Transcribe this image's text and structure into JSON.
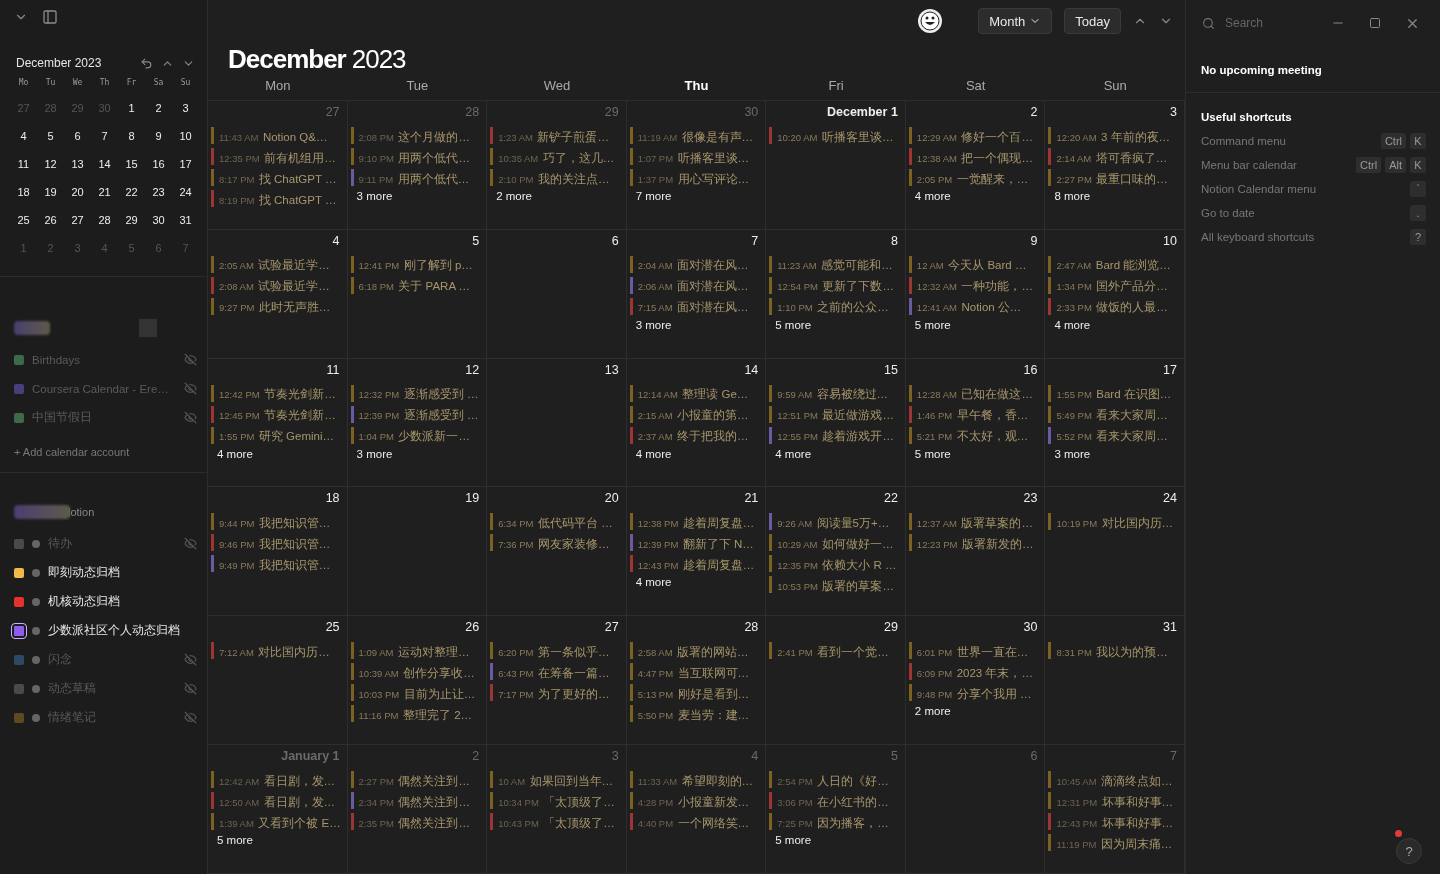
{
  "sidebar": {
    "mini_calendar": {
      "title": "December 2023",
      "weekdays": [
        "Mo",
        "Tu",
        "We",
        "Th",
        "Fr",
        "Sa",
        "Su"
      ],
      "days": [
        {
          "label": "27",
          "muted": true
        },
        {
          "label": "28",
          "muted": true
        },
        {
          "label": "29",
          "muted": true
        },
        {
          "label": "30",
          "muted": true
        },
        {
          "label": "1",
          "muted": false
        },
        {
          "label": "2",
          "muted": false
        },
        {
          "label": "3",
          "muted": false
        },
        {
          "label": "4",
          "muted": false
        },
        {
          "label": "5",
          "muted": false
        },
        {
          "label": "6",
          "muted": false
        },
        {
          "label": "7",
          "muted": false
        },
        {
          "label": "8",
          "muted": false
        },
        {
          "label": "9",
          "muted": false
        },
        {
          "label": "10",
          "muted": false
        },
        {
          "label": "11",
          "muted": false
        },
        {
          "label": "12",
          "muted": false
        },
        {
          "label": "13",
          "muted": false
        },
        {
          "label": "14",
          "muted": false
        },
        {
          "label": "15",
          "muted": false
        },
        {
          "label": "16",
          "muted": false
        },
        {
          "label": "17",
          "muted": false
        },
        {
          "label": "18",
          "muted": false
        },
        {
          "label": "19",
          "muted": false
        },
        {
          "label": "20",
          "muted": false
        },
        {
          "label": "21",
          "muted": false
        },
        {
          "label": "22",
          "muted": false
        },
        {
          "label": "23",
          "muted": false
        },
        {
          "label": "24",
          "muted": false
        },
        {
          "label": "25",
          "muted": false
        },
        {
          "label": "26",
          "muted": false
        },
        {
          "label": "27",
          "muted": false
        },
        {
          "label": "28",
          "muted": false
        },
        {
          "label": "29",
          "muted": false
        },
        {
          "label": "30",
          "muted": false
        },
        {
          "label": "31",
          "muted": false
        },
        {
          "label": "1",
          "muted": true
        },
        {
          "label": "2",
          "muted": true
        },
        {
          "label": "3",
          "muted": true
        },
        {
          "label": "4",
          "muted": true
        },
        {
          "label": "5",
          "muted": true
        },
        {
          "label": "6",
          "muted": true
        },
        {
          "label": "7",
          "muted": true
        }
      ]
    },
    "accounts": [
      {
        "calendars": [
          {
            "name": "Birthdays",
            "color": "#3d6b4a",
            "hidden": true
          },
          {
            "name": "Coursera Calendar - Ere…",
            "color": "#4a3f7a",
            "hidden": true
          },
          {
            "name": "中国节假日",
            "color": "#3d6b4a",
            "hidden": true
          }
        ],
        "add_label": "+ Add calendar account"
      },
      {
        "name": "lotion",
        "calendars": [
          {
            "name": "待办",
            "color": "#4a4a4a",
            "hidden": true,
            "selected": false
          },
          {
            "name": "即刻动态归档",
            "color": "#f2b84b",
            "hidden": false,
            "selected": false
          },
          {
            "name": "机核动态归档",
            "color": "#e5322d",
            "hidden": false,
            "selected": false
          },
          {
            "name": "少数派社区个人动态归档",
            "color": "#8f5cf2",
            "hidden": false,
            "selected": true
          },
          {
            "name": "闪念",
            "color": "#2d4a66",
            "hidden": true,
            "selected": false
          },
          {
            "name": "动态草稿",
            "color": "#4a4a4a",
            "hidden": true,
            "selected": false
          },
          {
            "name": "情绪笔记",
            "color": "#5e4a1e",
            "hidden": true,
            "selected": false
          }
        ]
      }
    ]
  },
  "toolbar": {
    "view": "Month",
    "today": "Today"
  },
  "calendar": {
    "title_month": "December",
    "title_year": "2023",
    "weekdays": [
      {
        "label": "Mon",
        "current": false
      },
      {
        "label": "Tue",
        "current": false
      },
      {
        "label": "Wed",
        "current": false
      },
      {
        "label": "Thu",
        "current": true
      },
      {
        "label": "Fri",
        "current": false
      },
      {
        "label": "Sat",
        "current": false
      },
      {
        "label": "Sun",
        "current": false
      }
    ],
    "days": [
      {
        "label": "27",
        "muted": true,
        "events": [
          {
            "time": "11:43 AM",
            "title": "Notion Q&…",
            "color": "#7d6120"
          },
          {
            "time": "12:35 PM",
            "title": "前有机组用…",
            "color": "#9e3535"
          },
          {
            "time": "8:17 PM",
            "title": "找 ChatGPT …",
            "color": "#7d6120"
          },
          {
            "time": "8:19 PM",
            "title": "找 ChatGPT …",
            "color": "#9e3535"
          }
        ]
      },
      {
        "label": "28",
        "muted": true,
        "events": [
          {
            "time": "2:08 PM",
            "title": "这个月做的…",
            "color": "#7d6120"
          },
          {
            "time": "9:10 PM",
            "title": "用两个低代…",
            "color": "#7d6120"
          },
          {
            "time": "9:11 PM",
            "title": "用两个低代…",
            "color": "#6a5aa0"
          }
        ],
        "more": "3 more"
      },
      {
        "label": "29",
        "muted": true,
        "events": [
          {
            "time": "1:23 AM",
            "title": "新铲子煎蛋…",
            "color": "#9e3535"
          },
          {
            "time": "10:35 AM",
            "title": "巧了，这几…",
            "color": "#7d6120"
          },
          {
            "time": "2:10 PM",
            "title": "我的关注点…",
            "color": "#7d6120"
          }
        ],
        "more": "2 more"
      },
      {
        "label": "30",
        "muted": true,
        "events": [
          {
            "time": "11:19 AM",
            "title": "很像是有声…",
            "color": "#7d6120"
          },
          {
            "time": "1:07 PM",
            "title": "听播客里谈…",
            "color": "#7d6120"
          },
          {
            "time": "1:37 PM",
            "title": "用心写评论…",
            "color": "#7d6120"
          }
        ],
        "more": "7 more"
      },
      {
        "label": "December 1",
        "muted": false,
        "month_start": true,
        "events": [
          {
            "time": "10:20 AM",
            "title": "听播客里谈…",
            "color": "#9e3535"
          }
        ]
      },
      {
        "label": "2",
        "muted": false,
        "events": [
          {
            "time": "12:29 AM",
            "title": "修好一个百…",
            "color": "#7d6120"
          },
          {
            "time": "12:38 AM",
            "title": "把一个偶现…",
            "color": "#9e3535"
          },
          {
            "time": "2:05 PM",
            "title": "一觉醒来，…",
            "color": "#7d6120"
          }
        ],
        "more": "4 more"
      },
      {
        "label": "3",
        "muted": false,
        "events": [
          {
            "time": "12:20 AM",
            "title": "3 年前的夜…",
            "color": "#7d6120"
          },
          {
            "time": "2:14 AM",
            "title": "塔可香疯了…",
            "color": "#9e3535"
          },
          {
            "time": "2:27 PM",
            "title": "最重口味的…",
            "color": "#7d6120"
          }
        ],
        "more": "8 more"
      },
      {
        "label": "4",
        "muted": false,
        "events": [
          {
            "time": "2:05 AM",
            "title": "试验最近学…",
            "color": "#7d6120"
          },
          {
            "time": "2:08 AM",
            "title": "试验最近学…",
            "color": "#9e3535"
          },
          {
            "time": "9:27 PM",
            "title": "此时无声胜…",
            "color": "#7d6120"
          }
        ]
      },
      {
        "label": "5",
        "muted": false,
        "events": [
          {
            "time": "12:41 PM",
            "title": "刚了解到 p…",
            "color": "#7d6120"
          },
          {
            "time": "6:18 PM",
            "title": "关于 PARA …",
            "color": "#7d6120"
          }
        ]
      },
      {
        "label": "6",
        "muted": false
      },
      {
        "label": "7",
        "muted": false,
        "events": [
          {
            "time": "2:04 AM",
            "title": "面对潜在风…",
            "color": "#7d6120"
          },
          {
            "time": "2:06 AM",
            "title": "面对潜在风…",
            "color": "#6a5aa0"
          },
          {
            "time": "7:15 AM",
            "title": "面对潜在风…",
            "color": "#9e3535"
          }
        ],
        "more": "3 more"
      },
      {
        "label": "8",
        "muted": false,
        "events": [
          {
            "time": "11:23 AM",
            "title": "感觉可能和…",
            "color": "#7d6120"
          },
          {
            "time": "12:54 PM",
            "title": "更新了下数…",
            "color": "#7d6120"
          },
          {
            "time": "1:10 PM",
            "title": "之前的公众…",
            "color": "#7d6120"
          }
        ],
        "more": "5 more"
      },
      {
        "label": "9",
        "muted": false,
        "events": [
          {
            "time": "12 AM",
            "title": "今天从 Bard …",
            "color": "#7d6120"
          },
          {
            "time": "12:32 AM",
            "title": "一种功能，…",
            "color": "#9e3535"
          },
          {
            "time": "12:41 AM",
            "title": "Notion 公…",
            "color": "#6a5aa0"
          }
        ],
        "more": "5 more"
      },
      {
        "label": "10",
        "muted": false,
        "events": [
          {
            "time": "2:47 AM",
            "title": "Bard 能浏览…",
            "color": "#7d6120"
          },
          {
            "time": "1:34 PM",
            "title": "国外产品分…",
            "color": "#7d6120"
          },
          {
            "time": "2:33 PM",
            "title": "做饭的人最…",
            "color": "#9e3535"
          }
        ],
        "more": "4 more"
      },
      {
        "label": "11",
        "muted": false,
        "events": [
          {
            "time": "12:42 PM",
            "title": "节奏光剑新…",
            "color": "#7d6120"
          },
          {
            "time": "12:45 PM",
            "title": "节奏光剑新…",
            "color": "#9e3535"
          },
          {
            "time": "1:55 PM",
            "title": "研究 Gemini…",
            "color": "#7d6120"
          }
        ],
        "more": "4 more"
      },
      {
        "label": "12",
        "muted": false,
        "events": [
          {
            "time": "12:32 PM",
            "title": "逐渐感受到 …",
            "color": "#7d6120"
          },
          {
            "time": "12:39 PM",
            "title": "逐渐感受到 …",
            "color": "#6a5aa0"
          },
          {
            "time": "1:04 PM",
            "title": "少数派新一…",
            "color": "#7d6120"
          }
        ],
        "more": "3 more"
      },
      {
        "label": "13",
        "muted": false
      },
      {
        "label": "14",
        "muted": false,
        "events": [
          {
            "time": "12:14 AM",
            "title": "整理读 Ge…",
            "color": "#7d6120"
          },
          {
            "time": "2:15 AM",
            "title": "小报童的第…",
            "color": "#7d6120"
          },
          {
            "time": "2:37 AM",
            "title": "终于把我的…",
            "color": "#9e3535"
          }
        ],
        "more": "4 more"
      },
      {
        "label": "15",
        "muted": false,
        "events": [
          {
            "time": "9:59 AM",
            "title": "容易被绕过…",
            "color": "#7d6120"
          },
          {
            "time": "12:51 PM",
            "title": "最近做游戏…",
            "color": "#7d6120"
          },
          {
            "time": "12:55 PM",
            "title": "趁着游戏开…",
            "color": "#6a5aa0"
          }
        ],
        "more": "4 more"
      },
      {
        "label": "16",
        "muted": false,
        "events": [
          {
            "time": "12:28 AM",
            "title": "已知在做这…",
            "color": "#7d6120"
          },
          {
            "time": "1:46 PM",
            "title": "早午餐，香…",
            "color": "#9e3535"
          },
          {
            "time": "5:21 PM",
            "title": "不太好，观…",
            "color": "#7d6120"
          }
        ],
        "more": "5 more"
      },
      {
        "label": "17",
        "muted": false,
        "events": [
          {
            "time": "1:55 PM",
            "title": "Bard 在识图…",
            "color": "#7d6120"
          },
          {
            "time": "5:49 PM",
            "title": "看来大家周…",
            "color": "#7d6120"
          },
          {
            "time": "5:52 PM",
            "title": "看来大家周…",
            "color": "#6a5aa0"
          }
        ],
        "more": "3 more"
      },
      {
        "label": "18",
        "muted": false,
        "events": [
          {
            "time": "9:44 PM",
            "title": "我把知识管…",
            "color": "#7d6120"
          },
          {
            "time": "9:46 PM",
            "title": "我把知识管…",
            "color": "#9e3535"
          },
          {
            "time": "9:49 PM",
            "title": "我把知识管…",
            "color": "#6a5aa0"
          }
        ]
      },
      {
        "label": "19",
        "muted": false
      },
      {
        "label": "20",
        "muted": false,
        "events": [
          {
            "time": "6:34 PM",
            "title": "低代码平台 …",
            "color": "#7d6120"
          },
          {
            "time": "7:36 PM",
            "title": "网友家装修…",
            "color": "#7d6120"
          }
        ]
      },
      {
        "label": "21",
        "muted": false,
        "events": [
          {
            "time": "12:38 PM",
            "title": "趁着周复盘…",
            "color": "#7d6120"
          },
          {
            "time": "12:39 PM",
            "title": "翻新了下 N…",
            "color": "#6a5aa0"
          },
          {
            "time": "12:43 PM",
            "title": "趁着周复盘…",
            "color": "#9e3535"
          }
        ],
        "more": "4 more"
      },
      {
        "label": "22",
        "muted": false,
        "events": [
          {
            "time": "9:26 AM",
            "title": "阅读量5万+…",
            "color": "#6a5aa0"
          },
          {
            "time": "10:29 AM",
            "title": "如何做好一…",
            "color": "#7d6120"
          },
          {
            "time": "12:35 PM",
            "title": "依赖大小 R …",
            "color": "#7d6120"
          },
          {
            "time": "10:53 PM",
            "title": "版署的草案…",
            "color": "#7d6120"
          }
        ]
      },
      {
        "label": "23",
        "muted": false,
        "events": [
          {
            "time": "12:37 AM",
            "title": "版署草案的…",
            "color": "#7d6120"
          },
          {
            "time": "12:23 PM",
            "title": "版署新发的…",
            "color": "#7d6120"
          }
        ]
      },
      {
        "label": "24",
        "muted": false,
        "events": [
          {
            "time": "10:19 PM",
            "title": "对比国内历…",
            "color": "#7d6120"
          }
        ]
      },
      {
        "label": "25",
        "muted": false,
        "events": [
          {
            "time": "7:12 AM",
            "title": "对比国内历…",
            "color": "#9e3535"
          }
        ]
      },
      {
        "label": "26",
        "muted": false,
        "events": [
          {
            "time": "1:09 AM",
            "title": "运动对整理…",
            "color": "#7d6120"
          },
          {
            "time": "10:39 AM",
            "title": "创作分享收…",
            "color": "#7d6120"
          },
          {
            "time": "10:03 PM",
            "title": "目前为止让…",
            "color": "#7d6120"
          },
          {
            "time": "11:16 PM",
            "title": "整理完了 2…",
            "color": "#7d6120"
          }
        ]
      },
      {
        "label": "27",
        "muted": false,
        "events": [
          {
            "time": "6:20 PM",
            "title": "第一条似乎…",
            "color": "#7d6120"
          },
          {
            "time": "6:43 PM",
            "title": "在筹备一篇…",
            "color": "#6a5aa0"
          },
          {
            "time": "7:17 PM",
            "title": "为了更好的…",
            "color": "#9e3535"
          }
        ]
      },
      {
        "label": "28",
        "muted": false,
        "events": [
          {
            "time": "2:58 AM",
            "title": "版署的网站…",
            "color": "#7d6120"
          },
          {
            "time": "4:47 PM",
            "title": "当互联网可…",
            "color": "#7d6120"
          },
          {
            "time": "5:13 PM",
            "title": "刚好是看到…",
            "color": "#7d6120"
          },
          {
            "time": "5:50 PM",
            "title": "麦当劳：建…",
            "color": "#7d6120"
          }
        ]
      },
      {
        "label": "29",
        "muted": false,
        "events": [
          {
            "time": "2:41 PM",
            "title": "看到一个觉…",
            "color": "#7d6120"
          }
        ]
      },
      {
        "label": "30",
        "muted": false,
        "events": [
          {
            "time": "6:01 PM",
            "title": "世界一直在…",
            "color": "#7d6120"
          },
          {
            "time": "6:09 PM",
            "title": "2023 年末，…",
            "color": "#9e3535"
          },
          {
            "time": "9:48 PM",
            "title": "分享个我用 …",
            "color": "#7d6120"
          }
        ],
        "more": "2 more"
      },
      {
        "label": "31",
        "muted": false,
        "events": [
          {
            "time": "8:31 PM",
            "title": "我以为的预…",
            "color": "#7d6120"
          }
        ]
      },
      {
        "label": "January 1",
        "muted": true,
        "month_start": true,
        "events": [
          {
            "time": "12:42 AM",
            "title": "看日剧，发…",
            "color": "#7d6120"
          },
          {
            "time": "12:50 AM",
            "title": "看日剧，发…",
            "color": "#9e3535"
          },
          {
            "time": "1:39 AM",
            "title": "又看到个被 E…",
            "color": "#7d6120"
          }
        ],
        "more": "5 more"
      },
      {
        "label": "2",
        "muted": true,
        "events": [
          {
            "time": "2:27 PM",
            "title": "偶然关注到…",
            "color": "#7d6120"
          },
          {
            "time": "2:34 PM",
            "title": "偶然关注到…",
            "color": "#6a5aa0"
          },
          {
            "time": "2:35 PM",
            "title": "偶然关注到…",
            "color": "#9e3535"
          }
        ]
      },
      {
        "label": "3",
        "muted": true,
        "events": [
          {
            "time": "10 AM",
            "title": "如果回到当年…",
            "color": "#7d6120"
          },
          {
            "time": "10:34 PM",
            "title": "「太顶级了…",
            "color": "#7d6120"
          },
          {
            "time": "10:43 PM",
            "title": "「太顶级了…",
            "color": "#9e3535"
          }
        ]
      },
      {
        "label": "4",
        "muted": true,
        "events": [
          {
            "time": "11:33 AM",
            "title": "希望即刻的…",
            "color": "#7d6120"
          },
          {
            "time": "4:28 PM",
            "title": "小报童新发…",
            "color": "#7d6120"
          },
          {
            "time": "4:40 PM",
            "title": "一个网络笑…",
            "color": "#9e3535"
          }
        ]
      },
      {
        "label": "5",
        "muted": true,
        "events": [
          {
            "time": "2:54 PM",
            "title": "人日的《好…",
            "color": "#7d6120"
          },
          {
            "time": "3:06 PM",
            "title": "在小红书的…",
            "color": "#9e3535"
          },
          {
            "time": "7:25 PM",
            "title": "因为播客，…",
            "color": "#7d6120"
          }
        ],
        "more": "5 more"
      },
      {
        "label": "6",
        "muted": true
      },
      {
        "label": "7",
        "muted": true,
        "events": [
          {
            "time": "10:45 AM",
            "title": "滴滴终点如…",
            "color": "#7d6120"
          },
          {
            "time": "12:31 PM",
            "title": "坏事和好事…",
            "color": "#7d6120"
          },
          {
            "time": "12:43 PM",
            "title": "坏事和好事…",
            "color": "#9e3535"
          },
          {
            "time": "11:19 PM",
            "title": "因为周末痛…",
            "color": "#7d6120"
          }
        ]
      }
    ]
  },
  "right_panel": {
    "search": {
      "placeholder": "Search"
    },
    "upcoming": "No upcoming meeting",
    "shortcuts_title": "Useful shortcuts",
    "shortcuts": [
      {
        "label": "Command menu",
        "keys": [
          "Ctrl",
          "K"
        ]
      },
      {
        "label": "Menu bar calendar",
        "keys": [
          "Ctrl",
          "Alt",
          "K"
        ]
      },
      {
        "label": "Notion Calendar menu",
        "keys": [
          "`"
        ]
      },
      {
        "label": "Go to date",
        "keys": [
          "."
        ]
      },
      {
        "label": "All keyboard shortcuts",
        "keys": [
          "?"
        ]
      }
    ],
    "help": "?"
  }
}
